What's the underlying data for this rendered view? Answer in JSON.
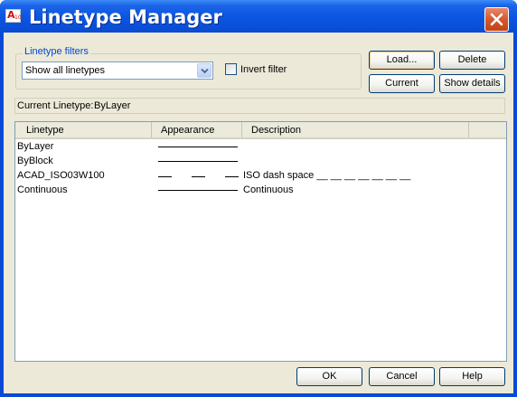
{
  "window": {
    "title": "Linetype Manager",
    "app_icon_letter": "A",
    "app_icon_number": "10"
  },
  "filters": {
    "legend": "Linetype filters",
    "selected_option": "Show all linetypes",
    "invert_label": "Invert filter",
    "invert_checked": false
  },
  "buttons": {
    "load": "Load...",
    "delete": "Delete",
    "current": "Current",
    "show_details": "Show details",
    "ok": "OK",
    "cancel": "Cancel",
    "help": "Help"
  },
  "current_linetype": {
    "label": "Current Linetype:",
    "value": "ByLayer"
  },
  "table": {
    "columns": [
      "Linetype",
      "Appearance",
      "Description"
    ],
    "rows": [
      {
        "linetype": "ByLayer",
        "appearance": "solid",
        "description": ""
      },
      {
        "linetype": "ByBlock",
        "appearance": "solid",
        "description": ""
      },
      {
        "linetype": "ACAD_ISO03W100",
        "appearance": "dashed",
        "description": "ISO dash space __ __ __ __ __ __ __"
      },
      {
        "linetype": "Continuous",
        "appearance": "solid",
        "description": "Continuous"
      }
    ]
  },
  "colors": {
    "title_bar": "#0a4fd8",
    "close_button": "#d4582c",
    "dialog_bg": "#ece9d8",
    "groupbox_label": "#0046d5"
  }
}
